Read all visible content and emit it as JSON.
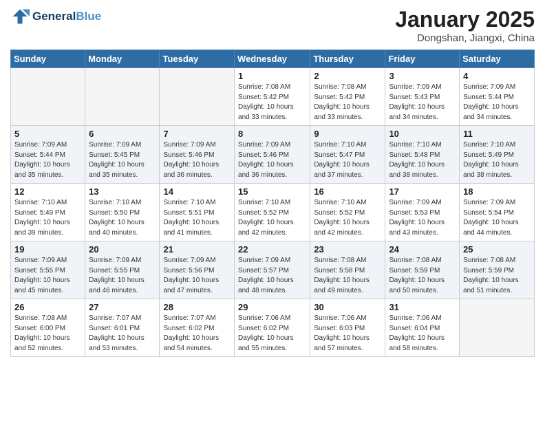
{
  "header": {
    "logo_general": "General",
    "logo_blue": "Blue",
    "month_title": "January 2025",
    "location": "Dongshan, Jiangxi, China"
  },
  "days_of_week": [
    "Sunday",
    "Monday",
    "Tuesday",
    "Wednesday",
    "Thursday",
    "Friday",
    "Saturday"
  ],
  "weeks": [
    [
      {
        "day": "",
        "info": ""
      },
      {
        "day": "",
        "info": ""
      },
      {
        "day": "",
        "info": ""
      },
      {
        "day": "1",
        "info": "Sunrise: 7:08 AM\nSunset: 5:42 PM\nDaylight: 10 hours\nand 33 minutes."
      },
      {
        "day": "2",
        "info": "Sunrise: 7:08 AM\nSunset: 5:42 PM\nDaylight: 10 hours\nand 33 minutes."
      },
      {
        "day": "3",
        "info": "Sunrise: 7:09 AM\nSunset: 5:43 PM\nDaylight: 10 hours\nand 34 minutes."
      },
      {
        "day": "4",
        "info": "Sunrise: 7:09 AM\nSunset: 5:44 PM\nDaylight: 10 hours\nand 34 minutes."
      }
    ],
    [
      {
        "day": "5",
        "info": "Sunrise: 7:09 AM\nSunset: 5:44 PM\nDaylight: 10 hours\nand 35 minutes."
      },
      {
        "day": "6",
        "info": "Sunrise: 7:09 AM\nSunset: 5:45 PM\nDaylight: 10 hours\nand 35 minutes."
      },
      {
        "day": "7",
        "info": "Sunrise: 7:09 AM\nSunset: 5:46 PM\nDaylight: 10 hours\nand 36 minutes."
      },
      {
        "day": "8",
        "info": "Sunrise: 7:09 AM\nSunset: 5:46 PM\nDaylight: 10 hours\nand 36 minutes."
      },
      {
        "day": "9",
        "info": "Sunrise: 7:10 AM\nSunset: 5:47 PM\nDaylight: 10 hours\nand 37 minutes."
      },
      {
        "day": "10",
        "info": "Sunrise: 7:10 AM\nSunset: 5:48 PM\nDaylight: 10 hours\nand 38 minutes."
      },
      {
        "day": "11",
        "info": "Sunrise: 7:10 AM\nSunset: 5:49 PM\nDaylight: 10 hours\nand 38 minutes."
      }
    ],
    [
      {
        "day": "12",
        "info": "Sunrise: 7:10 AM\nSunset: 5:49 PM\nDaylight: 10 hours\nand 39 minutes."
      },
      {
        "day": "13",
        "info": "Sunrise: 7:10 AM\nSunset: 5:50 PM\nDaylight: 10 hours\nand 40 minutes."
      },
      {
        "day": "14",
        "info": "Sunrise: 7:10 AM\nSunset: 5:51 PM\nDaylight: 10 hours\nand 41 minutes."
      },
      {
        "day": "15",
        "info": "Sunrise: 7:10 AM\nSunset: 5:52 PM\nDaylight: 10 hours\nand 42 minutes."
      },
      {
        "day": "16",
        "info": "Sunrise: 7:10 AM\nSunset: 5:52 PM\nDaylight: 10 hours\nand 42 minutes."
      },
      {
        "day": "17",
        "info": "Sunrise: 7:09 AM\nSunset: 5:53 PM\nDaylight: 10 hours\nand 43 minutes."
      },
      {
        "day": "18",
        "info": "Sunrise: 7:09 AM\nSunset: 5:54 PM\nDaylight: 10 hours\nand 44 minutes."
      }
    ],
    [
      {
        "day": "19",
        "info": "Sunrise: 7:09 AM\nSunset: 5:55 PM\nDaylight: 10 hours\nand 45 minutes."
      },
      {
        "day": "20",
        "info": "Sunrise: 7:09 AM\nSunset: 5:55 PM\nDaylight: 10 hours\nand 46 minutes."
      },
      {
        "day": "21",
        "info": "Sunrise: 7:09 AM\nSunset: 5:56 PM\nDaylight: 10 hours\nand 47 minutes."
      },
      {
        "day": "22",
        "info": "Sunrise: 7:09 AM\nSunset: 5:57 PM\nDaylight: 10 hours\nand 48 minutes."
      },
      {
        "day": "23",
        "info": "Sunrise: 7:08 AM\nSunset: 5:58 PM\nDaylight: 10 hours\nand 49 minutes."
      },
      {
        "day": "24",
        "info": "Sunrise: 7:08 AM\nSunset: 5:59 PM\nDaylight: 10 hours\nand 50 minutes."
      },
      {
        "day": "25",
        "info": "Sunrise: 7:08 AM\nSunset: 5:59 PM\nDaylight: 10 hours\nand 51 minutes."
      }
    ],
    [
      {
        "day": "26",
        "info": "Sunrise: 7:08 AM\nSunset: 6:00 PM\nDaylight: 10 hours\nand 52 minutes."
      },
      {
        "day": "27",
        "info": "Sunrise: 7:07 AM\nSunset: 6:01 PM\nDaylight: 10 hours\nand 53 minutes."
      },
      {
        "day": "28",
        "info": "Sunrise: 7:07 AM\nSunset: 6:02 PM\nDaylight: 10 hours\nand 54 minutes."
      },
      {
        "day": "29",
        "info": "Sunrise: 7:06 AM\nSunset: 6:02 PM\nDaylight: 10 hours\nand 55 minutes."
      },
      {
        "day": "30",
        "info": "Sunrise: 7:06 AM\nSunset: 6:03 PM\nDaylight: 10 hours\nand 57 minutes."
      },
      {
        "day": "31",
        "info": "Sunrise: 7:06 AM\nSunset: 6:04 PM\nDaylight: 10 hours\nand 58 minutes."
      },
      {
        "day": "",
        "info": ""
      }
    ]
  ]
}
